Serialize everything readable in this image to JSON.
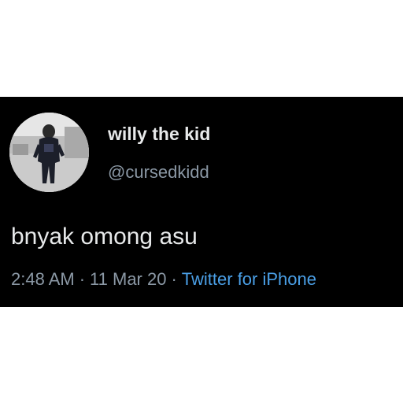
{
  "tweet": {
    "display_name": "willy the kid",
    "handle": "@cursedkidd",
    "text": "bnyak omong asu",
    "time": "2:48 AM",
    "date": "11 Mar 20",
    "separator": "·",
    "source": "Twitter for iPhone",
    "avatar_icon": "profile-photo-person-icon"
  },
  "colors": {
    "background": "#000000",
    "text": "#e7e9ea",
    "secondary_text": "#8b98a5",
    "link": "#4a9fe6"
  }
}
